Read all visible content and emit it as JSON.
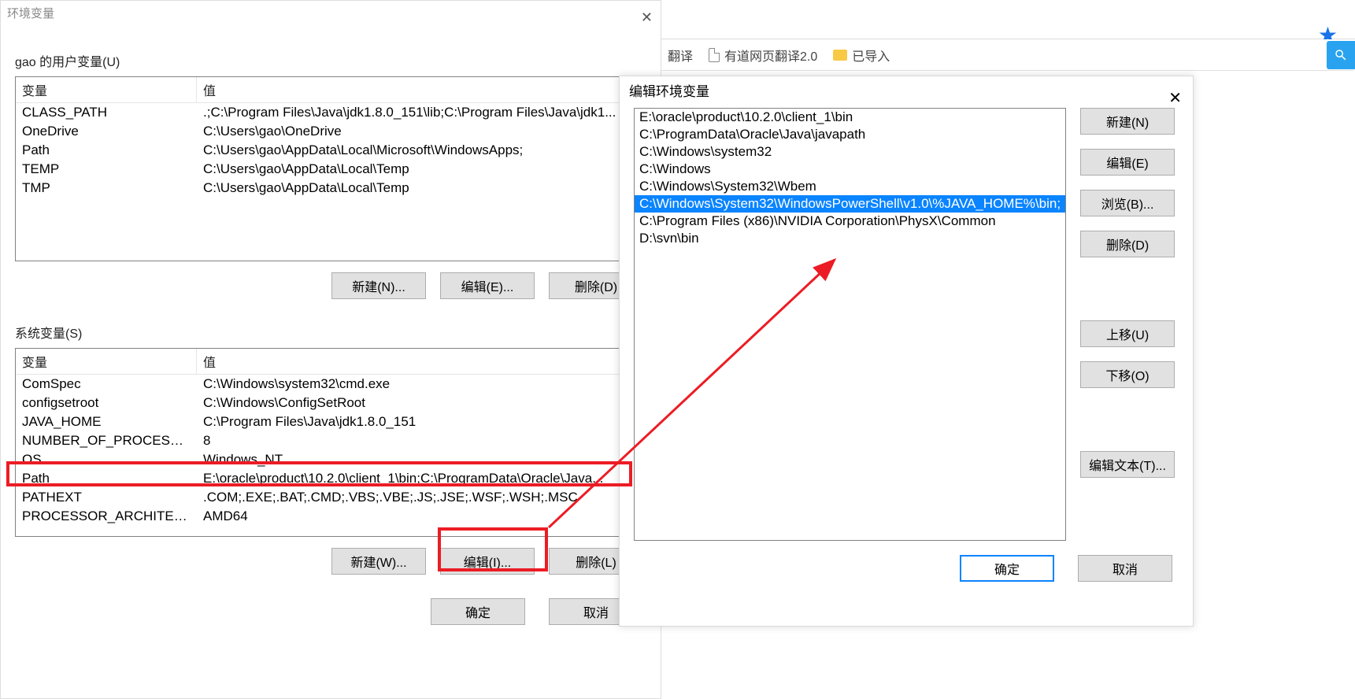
{
  "env_dialog": {
    "title": "环境变量",
    "user_section_label": "gao 的用户变量(U)",
    "system_section_label": "系统变量(S)",
    "columns": {
      "variable": "变量",
      "value": "值"
    },
    "user_vars": [
      {
        "name": "CLASS_PATH",
        "value": ".;C:\\Program Files\\Java\\jdk1.8.0_151\\lib;C:\\Program Files\\Java\\jdk1..."
      },
      {
        "name": "OneDrive",
        "value": "C:\\Users\\gao\\OneDrive"
      },
      {
        "name": "Path",
        "value": "C:\\Users\\gao\\AppData\\Local\\Microsoft\\WindowsApps;"
      },
      {
        "name": "TEMP",
        "value": "C:\\Users\\gao\\AppData\\Local\\Temp"
      },
      {
        "name": "TMP",
        "value": "C:\\Users\\gao\\AppData\\Local\\Temp"
      }
    ],
    "system_vars": [
      {
        "name": "ComSpec",
        "value": "C:\\Windows\\system32\\cmd.exe"
      },
      {
        "name": "configsetroot",
        "value": "C:\\Windows\\ConfigSetRoot"
      },
      {
        "name": "JAVA_HOME",
        "value": "C:\\Program Files\\Java\\jdk1.8.0_151"
      },
      {
        "name": "NUMBER_OF_PROCESSORS",
        "value": "8"
      },
      {
        "name": "OS",
        "value": "Windows_NT"
      },
      {
        "name": "Path",
        "value": "E:\\oracle\\product\\10.2.0\\client_1\\bin;C:\\ProgramData\\Oracle\\Java..."
      },
      {
        "name": "PATHEXT",
        "value": ".COM;.EXE;.BAT;.CMD;.VBS;.VBE;.JS;.JSE;.WSF;.WSH;.MSC"
      },
      {
        "name": "PROCESSOR_ARCHITECTURE",
        "value": "AMD64"
      }
    ],
    "buttons": {
      "user_new": "新建(N)...",
      "user_edit": "编辑(E)...",
      "user_delete": "删除(D)",
      "sys_new": "新建(W)...",
      "sys_edit": "编辑(I)...",
      "sys_delete": "删除(L)",
      "ok": "确定",
      "cancel": "取消"
    }
  },
  "edit_dialog": {
    "title": "编辑环境变量",
    "paths": [
      "E:\\oracle\\product\\10.2.0\\client_1\\bin",
      "C:\\ProgramData\\Oracle\\Java\\javapath",
      "C:\\Windows\\system32",
      "C:\\Windows",
      "C:\\Windows\\System32\\Wbem",
      "C:\\Windows\\System32\\WindowsPowerShell\\v1.0\\%JAVA_HOME%\\bin;",
      "C:\\Program Files (x86)\\NVIDIA Corporation\\PhysX\\Common",
      "D:\\svn\\bin"
    ],
    "selected_index": 5,
    "buttons": {
      "new": "新建(N)",
      "edit": "编辑(E)",
      "browse": "浏览(B)...",
      "delete": "删除(D)",
      "move_up": "上移(U)",
      "move_down": "下移(O)",
      "edit_text": "编辑文本(T)...",
      "ok": "确定",
      "cancel": "取消"
    }
  },
  "browser": {
    "bookmarks": {
      "translate": "翻译",
      "youdao": "有道网页翻译2.0",
      "imported": "已导入"
    }
  }
}
